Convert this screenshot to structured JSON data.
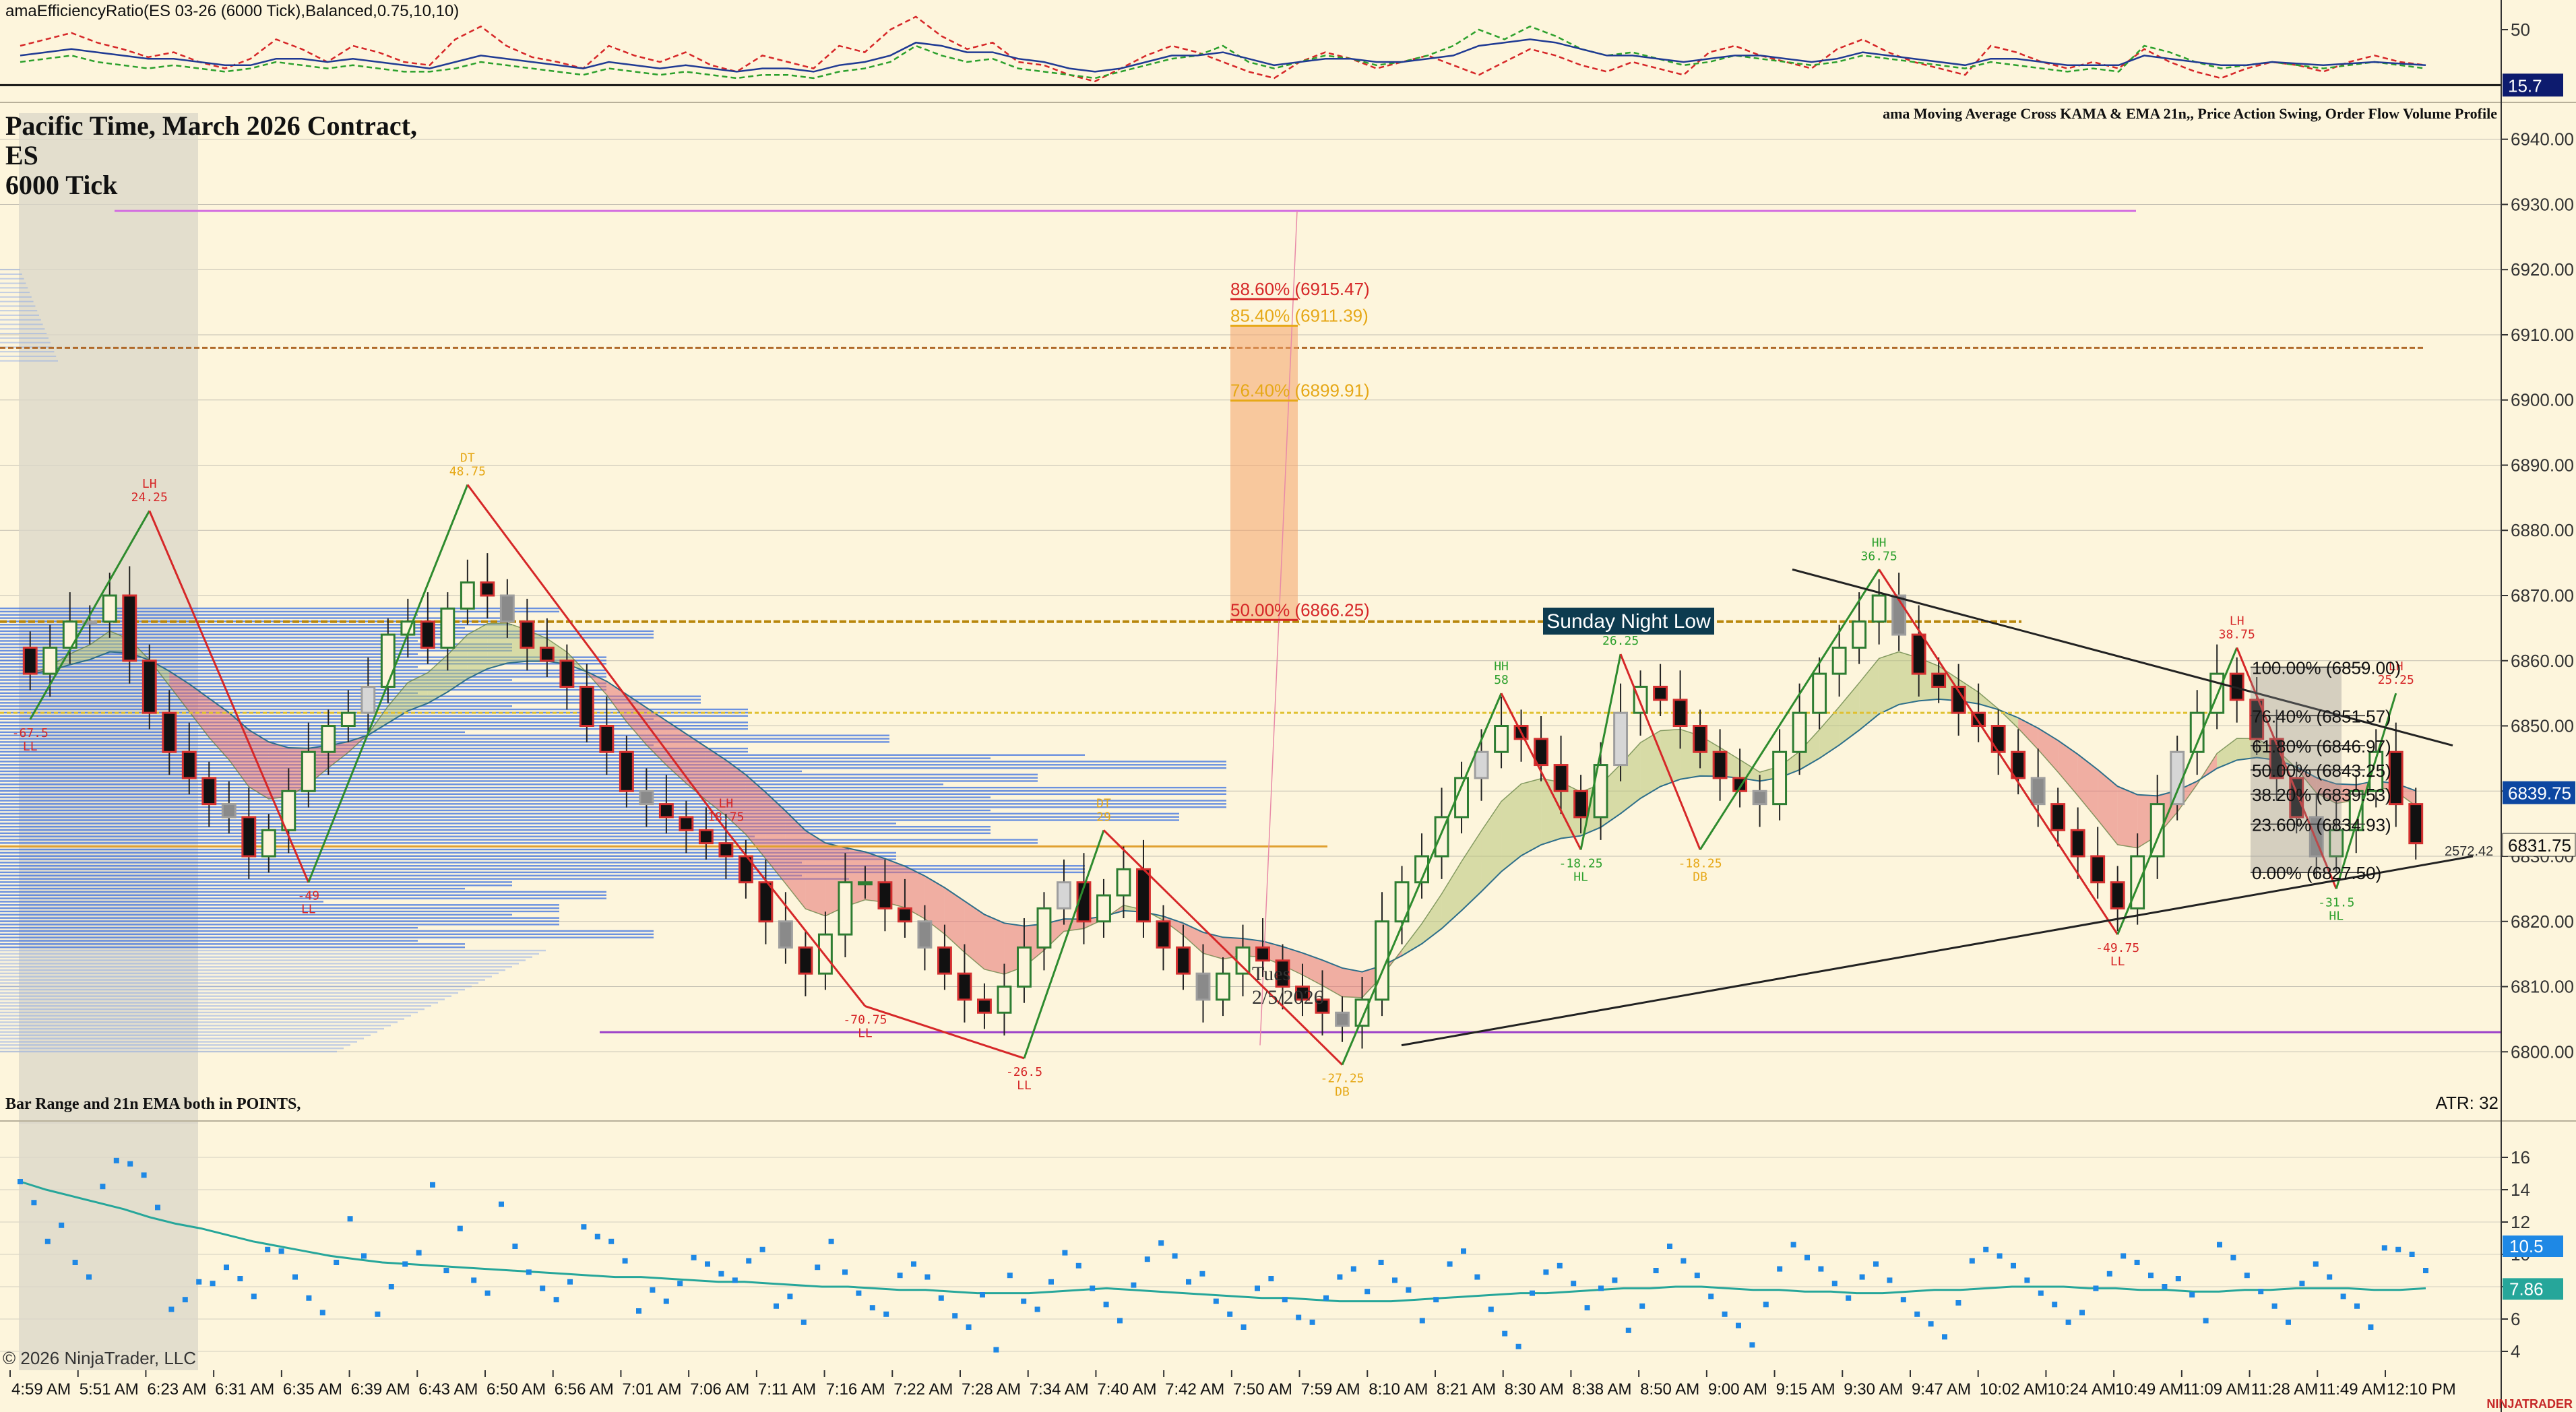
{
  "chart_data": [
    {
      "type": "line",
      "panel": "efficiency-ratio",
      "indicator_label": "amaEfficiencyRatio(ES 03-26 (6000 Tick),Balanced,0.75,10,10)",
      "y_ticks": [
        "50"
      ],
      "ylim": [
        10,
        60
      ],
      "current_value_label": "15.7",
      "reference_level": 15.7,
      "series": [
        {
          "color": "#d62728",
          "style": "dashed",
          "values": [
            40,
            44,
            48,
            42,
            38,
            33,
            36,
            30,
            26,
            32,
            44,
            38,
            30,
            40,
            36,
            30,
            28,
            44,
            52,
            40,
            33,
            30,
            26,
            40,
            34,
            30,
            36,
            28,
            24,
            34,
            30,
            26,
            40,
            36,
            50,
            58,
            46,
            38,
            42,
            30,
            28,
            22,
            18,
            26,
            34,
            40,
            36,
            30,
            24,
            20,
            30,
            36,
            32,
            26,
            30,
            34,
            28,
            22,
            30,
            38,
            34,
            28,
            24,
            30,
            26,
            22,
            36,
            40,
            34,
            30,
            26,
            38,
            44,
            36,
            30,
            26,
            22,
            40,
            36,
            30,
            26,
            30,
            26,
            38,
            30,
            24,
            20,
            26,
            30,
            28,
            24,
            30,
            34,
            30,
            28
          ]
        },
        {
          "color": "#2ca02c",
          "style": "dashed",
          "values": [
            30,
            32,
            34,
            30,
            28,
            26,
            28,
            26,
            24,
            26,
            30,
            28,
            26,
            28,
            26,
            24,
            24,
            26,
            30,
            28,
            26,
            24,
            22,
            26,
            24,
            22,
            24,
            22,
            20,
            22,
            22,
            20,
            24,
            26,
            30,
            40,
            34,
            30,
            32,
            26,
            24,
            22,
            20,
            24,
            28,
            32,
            34,
            40,
            30,
            26,
            30,
            34,
            32,
            28,
            30,
            34,
            40,
            50,
            44,
            52,
            46,
            38,
            34,
            36,
            32,
            28,
            30,
            34,
            32,
            30,
            28,
            30,
            34,
            32,
            30,
            28,
            26,
            30,
            28,
            26,
            24,
            26,
            24,
            40,
            36,
            30,
            26,
            28,
            30,
            28,
            26,
            28,
            30,
            28,
            26
          ]
        },
        {
          "color": "#1f3a93",
          "style": "solid",
          "values": [
            34,
            36,
            38,
            36,
            34,
            32,
            32,
            30,
            28,
            28,
            32,
            32,
            30,
            32,
            30,
            28,
            26,
            30,
            34,
            32,
            30,
            28,
            26,
            30,
            28,
            26,
            28,
            26,
            24,
            26,
            26,
            24,
            28,
            30,
            34,
            42,
            40,
            36,
            36,
            32,
            30,
            26,
            24,
            26,
            30,
            34,
            34,
            36,
            32,
            28,
            30,
            32,
            32,
            30,
            30,
            32,
            34,
            40,
            42,
            44,
            42,
            38,
            34,
            34,
            32,
            30,
            32,
            34,
            34,
            32,
            30,
            32,
            36,
            34,
            32,
            30,
            28,
            32,
            32,
            30,
            28,
            28,
            28,
            34,
            32,
            30,
            28,
            28,
            30,
            29,
            28,
            29,
            30,
            29,
            28
          ]
        }
      ]
    },
    {
      "type": "candlestick",
      "panel": "price",
      "title_lines": [
        "Pacific Time, March 2026 Contract,",
        "ES",
        "6000 Tick"
      ],
      "overlay_label": "ama Moving Average Cross KAMA & EMA 21n,, Price Action Swing, Order Flow Volume Profile",
      "ylim": [
        6796,
        6944
      ],
      "y_ticks": [
        "6800.00",
        "6810.00",
        "6820.00",
        "6830.00",
        "6840.00",
        "6850.00",
        "6860.00",
        "6870.00",
        "6880.00",
        "6890.00",
        "6900.00",
        "6910.00",
        "6920.00",
        "6930.00",
        "6940.00"
      ],
      "price_markers": [
        {
          "label": "6839.75",
          "value": 6839.75,
          "color": "#0d47a1"
        },
        {
          "label": "6831.75",
          "value": 6831.75,
          "color": "#fdf5dc"
        }
      ],
      "x_tick_labels": [
        "4:59 AM",
        "5:51 AM",
        "6:23 AM",
        "6:31 AM",
        "6:35 AM",
        "6:39 AM",
        "6:43 AM",
        "6:50 AM",
        "6:56 AM",
        "7:01 AM",
        "7:06 AM",
        "7:11 AM",
        "7:16 AM",
        "7:22 AM",
        "7:28 AM",
        "7:34 AM",
        "7:40 AM",
        "7:42 AM",
        "7:50 AM",
        "7:59 AM",
        "8:10 AM",
        "8:21 AM",
        "8:30 AM",
        "8:38 AM",
        "8:50 AM",
        "9:00 AM",
        "9:15 AM",
        "9:30 AM",
        "9:47 AM",
        "10:02 AM",
        "10:24 AM",
        "10:49 AM",
        "11:09 AM",
        "11:28 AM",
        "11:49 AM",
        "12:10 PM"
      ],
      "closes": [
        6858,
        6862,
        6866,
        6866,
        6870,
        6860,
        6852,
        6846,
        6842,
        6838,
        6836,
        6830,
        6834,
        6840,
        6846,
        6850,
        6852,
        6856,
        6864,
        6866,
        6862,
        6868,
        6872,
        6870,
        6866,
        6862,
        6860,
        6856,
        6850,
        6846,
        6840,
        6838,
        6836,
        6834,
        6832,
        6830,
        6826,
        6820,
        6816,
        6812,
        6818,
        6826,
        6826,
        6822,
        6820,
        6816,
        6812,
        6808,
        6806,
        6810,
        6816,
        6822,
        6826,
        6820,
        6824,
        6828,
        6820,
        6816,
        6812,
        6808,
        6812,
        6816,
        6814,
        6810,
        6808,
        6806,
        6804,
        6808,
        6820,
        6826,
        6830,
        6836,
        6842,
        6846,
        6850,
        6848,
        6844,
        6840,
        6836,
        6844,
        6852,
        6856,
        6854,
        6850,
        6846,
        6842,
        6840,
        6838,
        6846,
        6852,
        6858,
        6862,
        6866,
        6870,
        6864,
        6858,
        6856,
        6852,
        6850,
        6846,
        6842,
        6838,
        6834,
        6830,
        6826,
        6822,
        6830,
        6838,
        6846,
        6852,
        6858,
        6854,
        6848,
        6842,
        6836,
        6830,
        6834,
        6840,
        6846,
        6838,
        6832
      ],
      "swing_labels": [
        {
          "label": "-67.5",
          "sub": "LL",
          "color": "#d62728",
          "value": 6851
        },
        {
          "label": "LH",
          "sub": "24.25",
          "color": "#d62728",
          "value": 6883
        },
        {
          "label": "-49",
          "sub": "LL",
          "color": "#d62728",
          "value": 6826
        },
        {
          "label": "DT",
          "sub": "48.75",
          "color": "#e6a817",
          "value": 6887
        },
        {
          "label": "LH",
          "sub": "18.75",
          "color": "#d62728",
          "value": 6834
        },
        {
          "label": "-70.75",
          "sub": "LL",
          "color": "#d62728",
          "value": 6807
        },
        {
          "label": "-26.5",
          "sub": "LL",
          "color": "#d62728",
          "value": 6799
        },
        {
          "label": "DT",
          "sub": "29",
          "color": "#e6a817",
          "value": 6834
        },
        {
          "label": "-27.25",
          "sub": "DB",
          "color": "#e6a817",
          "value": 6798
        },
        {
          "label": "HH",
          "sub": "58",
          "color": "#2ca02c",
          "value": 6855
        },
        {
          "label": "-18.25",
          "sub": "HL",
          "color": "#2ca02c",
          "value": 6831
        },
        {
          "label": "HH",
          "sub": "26.25",
          "color": "#2ca02c",
          "value": 6861
        },
        {
          "label": "-18.25",
          "sub": "DB",
          "color": "#e6a817",
          "value": 6831
        },
        {
          "label": "HH",
          "sub": "36.75",
          "color": "#2ca02c",
          "value": 6874
        },
        {
          "label": "-49.75",
          "sub": "LL",
          "color": "#d62728",
          "value": 6818
        },
        {
          "label": "LH",
          "sub": "38.75",
          "color": "#d62728",
          "value": 6862
        },
        {
          "label": "-31.5",
          "sub": "HL",
          "color": "#2ca02c",
          "value": 6825
        },
        {
          "label": "LH",
          "sub": "25.25",
          "color": "#d62728",
          "value": 6855
        }
      ],
      "fib_retracement_a": [
        {
          "label": "88.60% (6915.47)",
          "value": 6915.47,
          "color": "#d62728"
        },
        {
          "label": "85.40% (6911.39)",
          "value": 6911.39,
          "color": "#e6a817"
        },
        {
          "label": "76.40% (6899.91)",
          "value": 6899.91,
          "color": "#e6a817"
        },
        {
          "label": "50.00% (6866.25)",
          "value": 6866.25,
          "color": "#d62728"
        }
      ],
      "fib_retracement_b": [
        {
          "label": "100.00% (6859.00)",
          "value": 6859.0
        },
        {
          "label": "76.40% (6851.57)",
          "value": 6851.57
        },
        {
          "label": "61.80% (6846.97)",
          "value": 6846.97
        },
        {
          "label": "50.00% (6843.25)",
          "value": 6843.25
        },
        {
          "label": "38.20% (6839.53)",
          "value": 6839.53
        },
        {
          "label": "23.60% (6834.93)",
          "value": 6834.93
        },
        {
          "label": "0.00% (6827.50)",
          "value": 6827.5
        }
      ],
      "annotations": {
        "sunday_night_low_label": "Sunday Night Low",
        "sunday_night_low_value": 6866,
        "date_note": "Tues\n2/5/2026",
        "count_label": "2572.42",
        "level_pink": 6929,
        "level_orange": 6908,
        "level_gold": 6852,
        "level_purple": 6803
      },
      "colors": {
        "up_candle": "#2e7d32",
        "down_candle": "#d32f2f",
        "neutral_candle": "#9e9e9e",
        "cloud_bear": "#e57373",
        "cloud_bull": "#b8c57a",
        "volume_profile": "#3a6fe0"
      }
    },
    {
      "type": "scatter",
      "panel": "bar-range",
      "indicator_label": "Bar Range and 21n EMA  both in POINTS,",
      "atr_label": "ATR: 32",
      "ylim": [
        3,
        18
      ],
      "y_ticks": [
        "4",
        "6",
        "8",
        "10",
        "12",
        "14",
        "16"
      ],
      "marker_labels": [
        {
          "label": "10.5",
          "value": 10.5,
          "color": "#1e88e5"
        },
        {
          "label": "7.86",
          "value": 7.86,
          "color": "#26a69a"
        }
      ],
      "dots": [
        14.5,
        13.2,
        10.8,
        11.8,
        9.5,
        8.6,
        14.2,
        15.8,
        15.6,
        14.9,
        12.9,
        6.6,
        7.2,
        8.3,
        8.2,
        9.2,
        8.5,
        7.4,
        10.3,
        10.2,
        8.6,
        7.3,
        6.4,
        9.5,
        12.2,
        9.9,
        6.3,
        8.0,
        9.4,
        10.1,
        14.3,
        9.0,
        11.6,
        8.4,
        7.6,
        13.1,
        10.5,
        8.9,
        7.9,
        7.2,
        8.3,
        11.7,
        11.1,
        10.8,
        9.6,
        6.5,
        7.8,
        7.1,
        8.2,
        9.8,
        9.4,
        8.8,
        8.4,
        9.6,
        10.3,
        6.8,
        7.4,
        5.8,
        9.2,
        10.8,
        8.9,
        7.6,
        6.7,
        6.3,
        8.7,
        9.4,
        8.6,
        7.3,
        6.2,
        5.5,
        7.5,
        4.1,
        8.7,
        7.1,
        6.6,
        8.3,
        10.1,
        9.3,
        7.9,
        6.9,
        5.9,
        8.1,
        9.7,
        10.7,
        9.9,
        8.3,
        8.8,
        7.1,
        6.3,
        5.5,
        7.9,
        8.5,
        7.2,
        6.1,
        5.8,
        7.3,
        8.6,
        9.1,
        7.7,
        9.5,
        8.4,
        7.8,
        5.9,
        7.2,
        9.4,
        10.2,
        8.6,
        6.6,
        5.1,
        4.3,
        7.6,
        8.9,
        9.3,
        8.2,
        6.7,
        7.9,
        8.4,
        5.3,
        6.8,
        9.0,
        10.5,
        9.6,
        8.7,
        7.4,
        6.3,
        5.6,
        4.4,
        6.9,
        9.1,
        10.6,
        9.8,
        9.1,
        8.2,
        7.3,
        8.6,
        9.4,
        8.4,
        7.2,
        6.3,
        5.7,
        4.9,
        7.0,
        9.6,
        10.3,
        9.9,
        9.3,
        8.4,
        7.6,
        6.9,
        5.8,
        6.4,
        7.9,
        8.8,
        9.9,
        9.5,
        8.7,
        8.0,
        8.5,
        7.5,
        5.9,
        10.6,
        9.8,
        8.7,
        7.7,
        6.8,
        5.8,
        8.2,
        9.4,
        8.6,
        7.4,
        6.8,
        5.5,
        10.4,
        10.3,
        10.0,
        9.0
      ],
      "ema": [
        14.5,
        14.0,
        13.6,
        13.2,
        12.8,
        12.3,
        11.9,
        11.6,
        11.2,
        10.8,
        10.5,
        10.2,
        9.9,
        9.7,
        9.5,
        9.4,
        9.3,
        9.2,
        9.1,
        9.0,
        8.9,
        8.8,
        8.7,
        8.6,
        8.6,
        8.5,
        8.4,
        8.3,
        8.3,
        8.2,
        8.1,
        8.0,
        8.0,
        7.9,
        7.8,
        7.8,
        7.7,
        7.6,
        7.6,
        7.6,
        7.7,
        7.8,
        7.9,
        7.8,
        7.7,
        7.6,
        7.5,
        7.4,
        7.3,
        7.3,
        7.2,
        7.1,
        7.1,
        7.1,
        7.2,
        7.3,
        7.4,
        7.5,
        7.6,
        7.6,
        7.7,
        7.8,
        7.9,
        7.9,
        8.0,
        8.0,
        7.9,
        7.8,
        7.8,
        7.7,
        7.7,
        7.6,
        7.6,
        7.7,
        7.8,
        7.8,
        7.9,
        8.0,
        8.0,
        8.0,
        7.9,
        7.9,
        7.8,
        7.8,
        7.7,
        7.7,
        7.8,
        7.8,
        7.9,
        7.9,
        7.9,
        7.8,
        7.8,
        7.9
      ]
    }
  ],
  "footer": {
    "copyright": "© 2026 NinjaTrader, LLC",
    "brand": "NINJATRADER"
  }
}
